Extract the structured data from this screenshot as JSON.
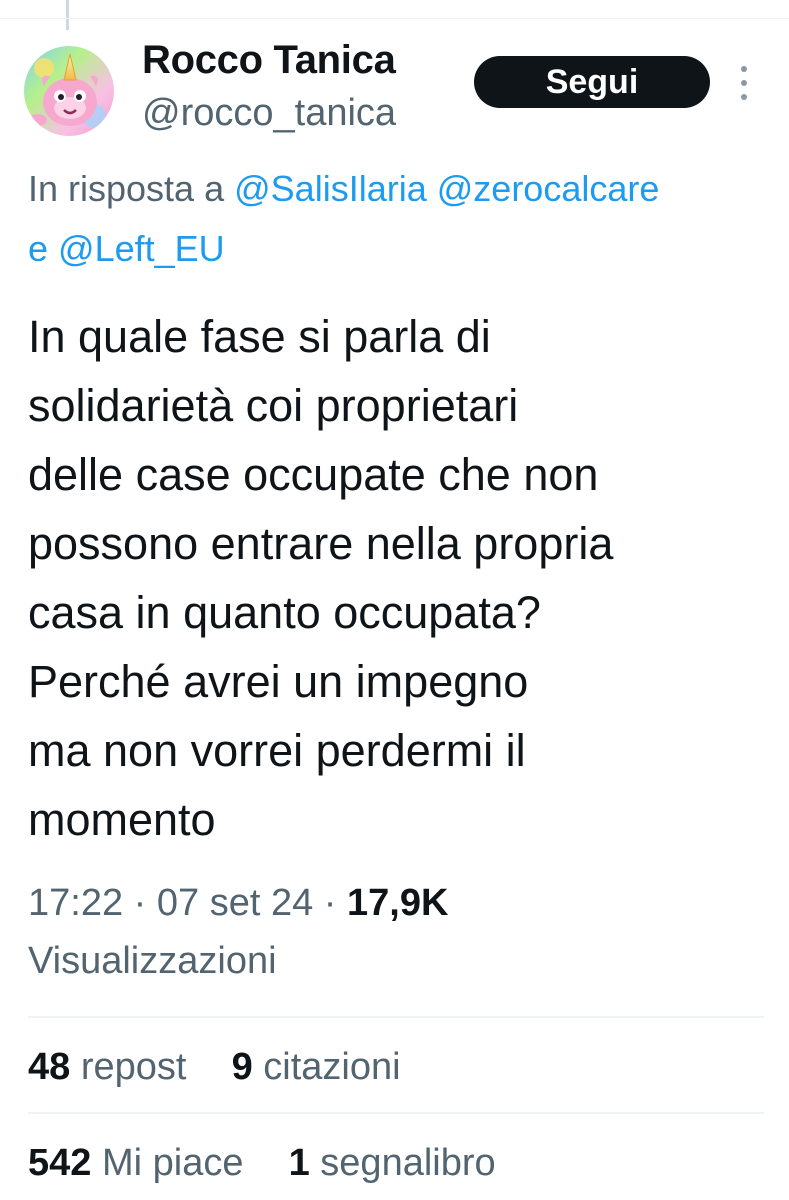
{
  "author": {
    "display_name": "Rocco Tanica",
    "handle": "@rocco_tanica"
  },
  "follow_label": "Segui",
  "reply": {
    "prefix": "In risposta a",
    "mentions": [
      "@SalisIlaria",
      "@zerocalcare"
    ],
    "joiner": "e",
    "last_mention": "@Left_EU"
  },
  "tweet_lines": [
    "In quale fase si parla di",
    "solidarietà coi proprietari",
    "delle case occupate che non",
    "possono entrare nella propria",
    "casa in quanto occupata?",
    "Perché avrei un impegno",
    "ma non vorrei perdermi il",
    "momento"
  ],
  "meta": {
    "time": "17:22",
    "separator": "·",
    "date": "07 set 24",
    "views_count": "17,9K",
    "views_label": "Visualizzazioni"
  },
  "stats": {
    "reposts_count": "48",
    "reposts_label": "repost",
    "quotes_count": "9",
    "quotes_label": "citazioni",
    "likes_count": "542",
    "likes_label": "Mi piace",
    "bookmarks_count": "1",
    "bookmarks_label": "segnalibro"
  },
  "colors": {
    "link": "#1d9bf0",
    "secondary_text": "#536471",
    "primary_text": "#0f1419",
    "button_bg": "#0f1419"
  }
}
